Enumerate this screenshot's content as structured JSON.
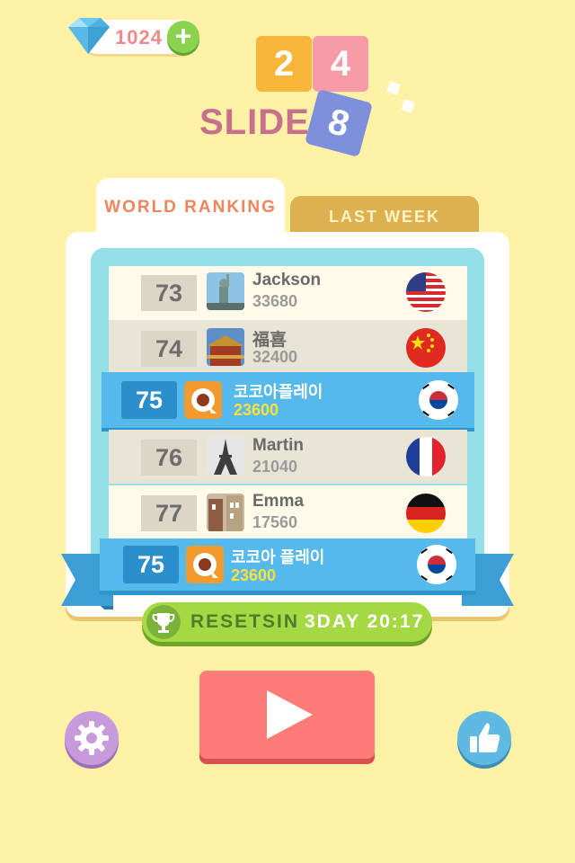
{
  "header": {
    "gems": "1024",
    "plus_symbol": "+"
  },
  "logo": {
    "tile_2": "2",
    "tile_4": "4",
    "tile_8": "8",
    "word": "SLIDE"
  },
  "tabs": {
    "world_ranking": "WORLD RANKING",
    "last_week": "LAST WEEK"
  },
  "rows": [
    {
      "rank": "73",
      "name": "Jackson",
      "score": "33680",
      "flag": "usa-flag",
      "thumb": "statue-of-liberty"
    },
    {
      "rank": "74",
      "name": "福喜",
      "score": "32400",
      "flag": "china-flag",
      "thumb": "chinese-temple"
    },
    {
      "rank": "76",
      "name": "Martin",
      "score": "21040",
      "flag": "france-flag",
      "thumb": "eiffel-tower"
    },
    {
      "rank": "77",
      "name": "Emma",
      "score": "17560",
      "flag": "germany-flag",
      "thumb": "german-building"
    }
  ],
  "me_in_list": {
    "rank": "75",
    "name": "코코아플레이",
    "score": "23600",
    "flag": "korea-flag"
  },
  "me_ribbon": {
    "rank": "75",
    "name": "코코아 플레이",
    "score": "23600",
    "flag": "korea-flag"
  },
  "resets": {
    "label": "RESETS",
    "in": "IN",
    "time": "3DAY 20:17"
  },
  "colors": {
    "background": "#FFF1A6",
    "accent_blue": "#55B9EC",
    "play_red": "#FF7C78",
    "green": "#A5D944"
  }
}
